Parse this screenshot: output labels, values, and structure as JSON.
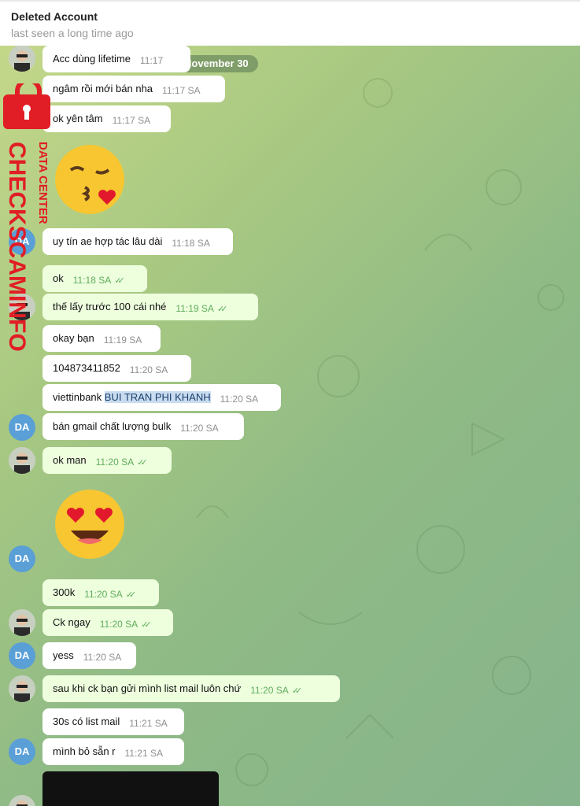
{
  "header": {
    "title": "Deleted Account",
    "subtitle": "last seen a long time ago"
  },
  "chat": {
    "date_label": "November 30",
    "messages": [
      {
        "text": "Acc dùng lifetime",
        "time": "11:17"
      },
      {
        "text": "ngâm rồi mới bán nha",
        "time": "11:17 SA"
      },
      {
        "text": "ok yên tâm",
        "time": "11:17 SA"
      },
      {
        "text": "uy tín ae hợp tác lâu dài",
        "time": "11:18 SA"
      },
      {
        "text": "ok",
        "time": "11:18 SA"
      },
      {
        "text": "thế lấy trước 100 cái nhé",
        "time": "11:19 SA"
      },
      {
        "text": "okay bạn",
        "time": "11:19 SA"
      },
      {
        "text": "104873411852",
        "time": "11:20 SA"
      },
      {
        "text_plain": "viettinbank ",
        "text_highlight": "BUI TRAN PHI KHANH",
        "time": "11:20 SA"
      },
      {
        "text": "bán gmail chất lượng bulk",
        "time": "11:20 SA"
      },
      {
        "text": "ok man",
        "time": "11:20 SA"
      },
      {
        "text": "300k",
        "time": "11:20 SA"
      },
      {
        "text": "Ck ngay",
        "time": "11:20 SA"
      },
      {
        "text": "yess",
        "time": "11:20 SA"
      },
      {
        "text": "sau khi ck bạn gửi mình list mail luôn chứ",
        "time": "11:20 SA"
      },
      {
        "text": "30s có list mail",
        "time": "11:21 SA"
      },
      {
        "text": "mình bỏ sẵn r",
        "time": "11:21 SA"
      }
    ],
    "avatar_initials": "DA",
    "read_ticks": "✓✓",
    "home_icon": "⌂"
  },
  "watermark": {
    "line1": "CHECKSCAMINFO",
    "line2": "DATA CENTER",
    "icon": "lock-icon",
    "color": "#e11d25"
  },
  "colors": {
    "incoming_bubble": "#ffffff",
    "outgoing_bubble": "#eeffde",
    "tick_green": "#5fad5c",
    "avatar_blue": "#5a9fd6"
  }
}
